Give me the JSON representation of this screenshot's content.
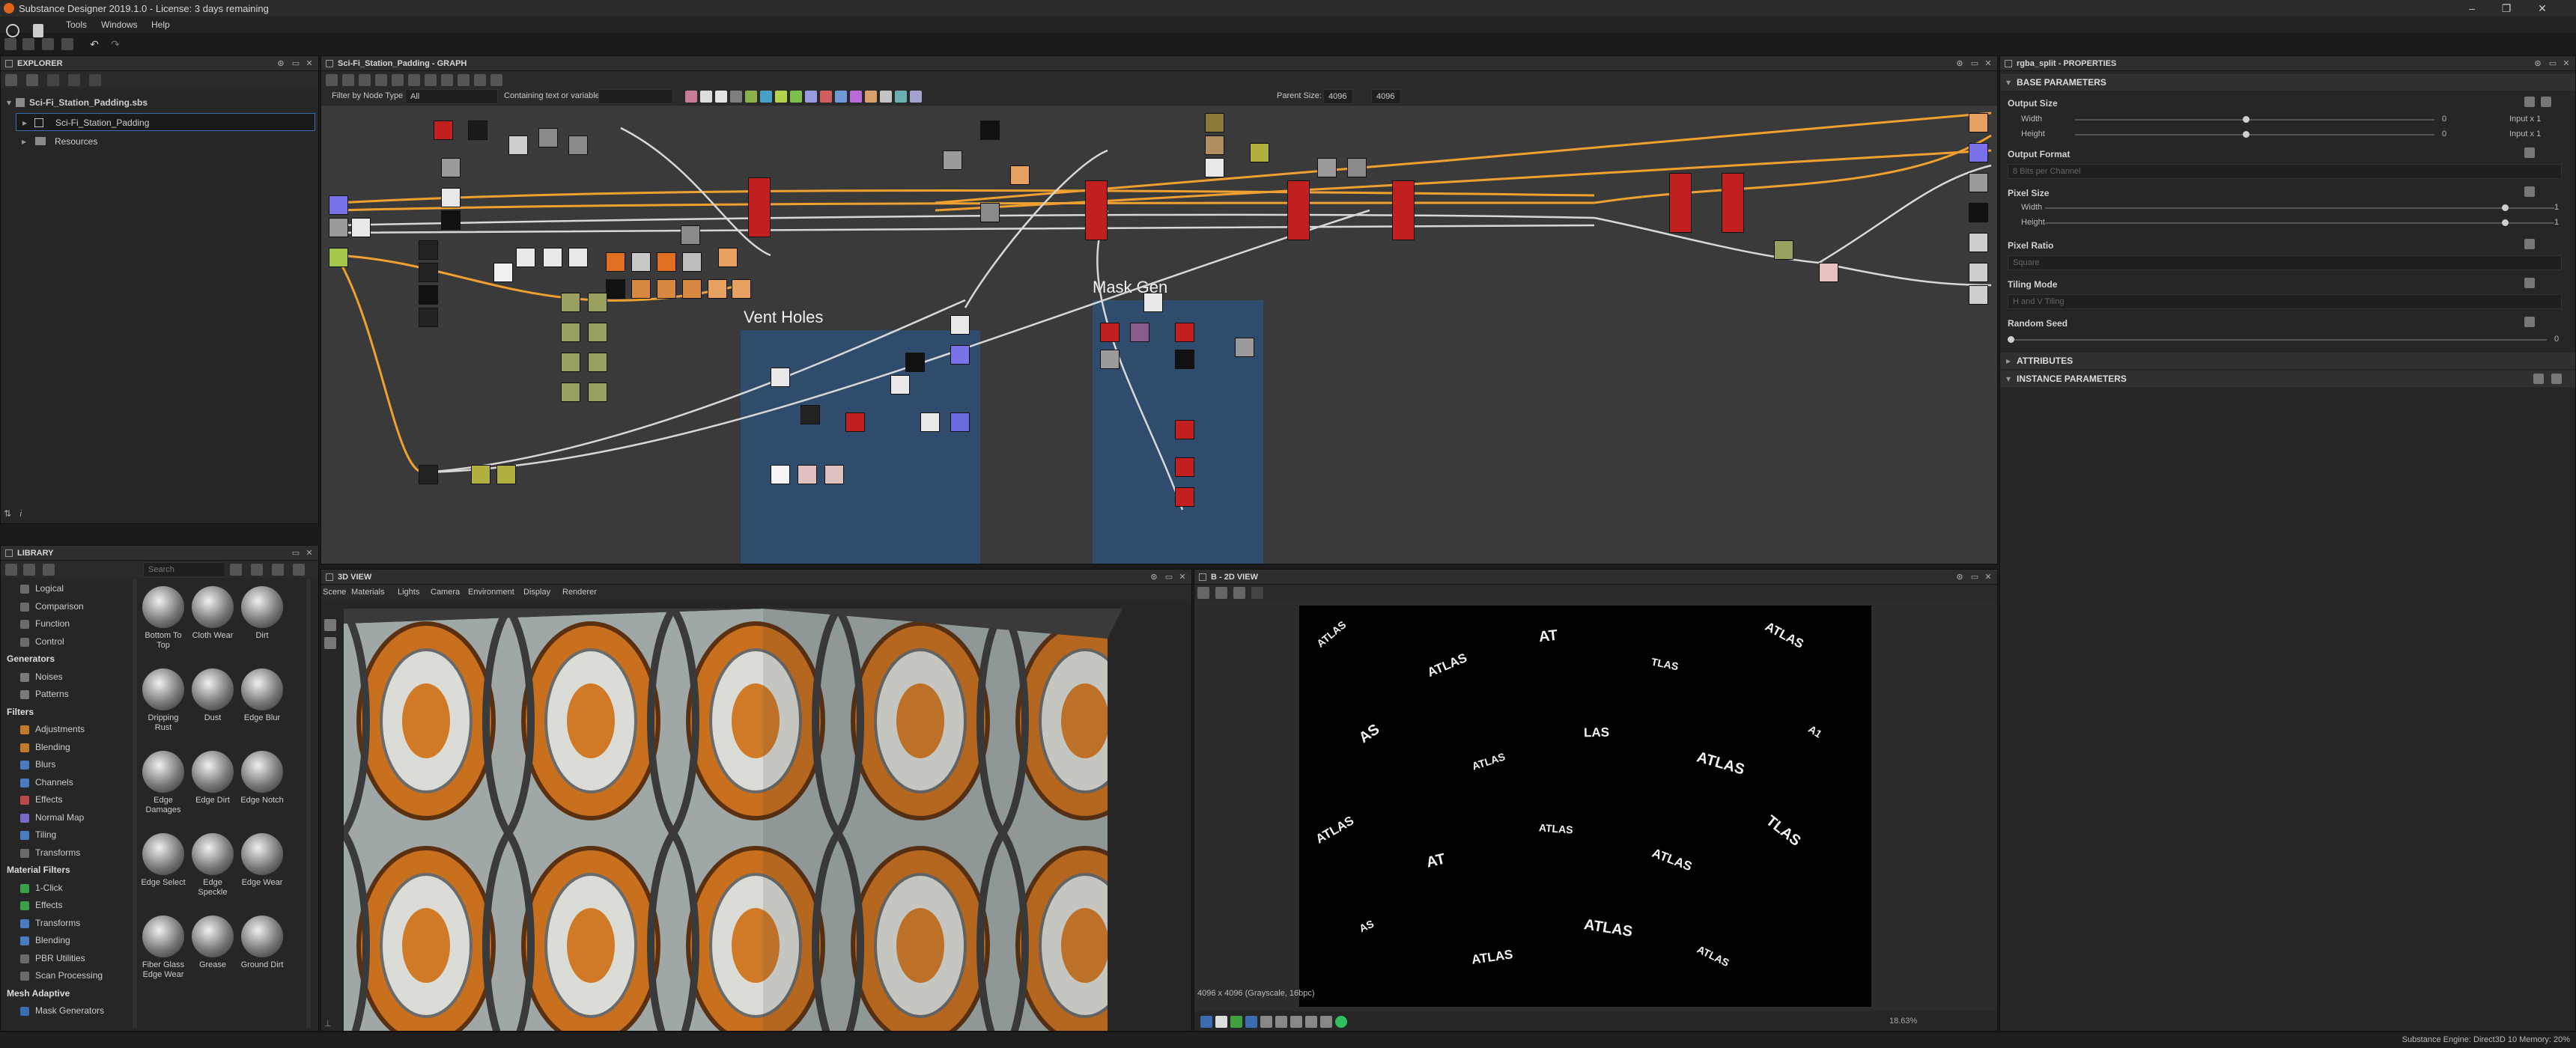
{
  "window": {
    "title": "Substance Designer 2019.1.0 - License: 3 days remaining",
    "controls": [
      "–",
      "❐",
      "✕"
    ]
  },
  "menubar": {
    "items": [
      "Tools",
      "Windows",
      "Help"
    ]
  },
  "explorer": {
    "title": "EXPLORER",
    "package": "Sci-Fi_Station_Padding.sbs",
    "graph": "Sci-Fi_Station_Padding",
    "folder": "Resources"
  },
  "graph_view": {
    "title": "Sci-Fi_Station_Padding - GRAPH",
    "filter_label": "Filter by Node Type",
    "filter_value": "All",
    "containing_label": "Containing text or variable",
    "parent_size_label": "Parent Size:",
    "parent_size_w": "4096",
    "parent_size_h": "4096",
    "frames": [
      {
        "title": "Vent Holes"
      },
      {
        "title": "Mask Gen"
      }
    ]
  },
  "library": {
    "title": "LIBRARY",
    "search_placeholder": "Search",
    "categories": [
      {
        "label": "Logical",
        "type": "item",
        "color": "#6b6b6b"
      },
      {
        "label": "Comparison",
        "type": "item",
        "color": "#6b6b6b"
      },
      {
        "label": "Function",
        "type": "item",
        "color": "#6b6b6b"
      },
      {
        "label": "Control",
        "type": "item",
        "color": "#6b6b6b"
      },
      {
        "label": "Generators",
        "type": "header"
      },
      {
        "label": "Noises",
        "type": "item",
        "color": "#7a7a7a"
      },
      {
        "label": "Patterns",
        "type": "item",
        "color": "#7a7a7a"
      },
      {
        "label": "Filters",
        "type": "header"
      },
      {
        "label": "Adjustments",
        "type": "item",
        "color": "#c07a2a"
      },
      {
        "label": "Blending",
        "type": "item",
        "color": "#c07a2a"
      },
      {
        "label": "Blurs",
        "type": "item",
        "color": "#4a7bc0"
      },
      {
        "label": "Channels",
        "type": "item",
        "color": "#4a7bc0"
      },
      {
        "label": "Effects",
        "type": "item",
        "color": "#b84a4a"
      },
      {
        "label": "Normal Map",
        "type": "item",
        "color": "#7a6ac8"
      },
      {
        "label": "Tiling",
        "type": "item",
        "color": "#4a7bc0"
      },
      {
        "label": "Transforms",
        "type": "item",
        "color": "#6b6b6b"
      },
      {
        "label": "Material Filters",
        "type": "header"
      },
      {
        "label": "1-Click",
        "type": "item",
        "color": "#3aa04a"
      },
      {
        "label": "Effects",
        "type": "item",
        "color": "#3aa04a"
      },
      {
        "label": "Transforms",
        "type": "item",
        "color": "#4a7bc0"
      },
      {
        "label": "Blending",
        "type": "item",
        "color": "#4a7bc0"
      },
      {
        "label": "PBR Utilities",
        "type": "item",
        "color": "#6b6b6b"
      },
      {
        "label": "Scan Processing",
        "type": "item",
        "color": "#6b6b6b"
      },
      {
        "label": "Mesh Adaptive",
        "type": "header"
      },
      {
        "label": "Mask Generators",
        "type": "item",
        "color": "#3a6cb0"
      }
    ],
    "thumbnails": [
      {
        "label": "Bottom To Top"
      },
      {
        "label": "Cloth Wear"
      },
      {
        "label": "Dirt"
      },
      {
        "label": "Dripping Rust"
      },
      {
        "label": "Dust"
      },
      {
        "label": "Edge Blur"
      },
      {
        "label": "Edge Damages"
      },
      {
        "label": "Edge Dirt"
      },
      {
        "label": "Edge Notch"
      },
      {
        "label": "Edge Select"
      },
      {
        "label": "Edge Speckle"
      },
      {
        "label": "Edge Wear"
      },
      {
        "label": "Fiber Glass Edge Wear"
      },
      {
        "label": "Grease"
      },
      {
        "label": "Ground Dirt"
      }
    ]
  },
  "view3d": {
    "title": "3D VIEW",
    "menu": [
      "Scene",
      "Materials",
      "Lights",
      "Camera",
      "Environment",
      "Display",
      "Renderer"
    ]
  },
  "view2d": {
    "title": "B - 2D VIEW",
    "info": "4096 x 4096 (Grayscale, 16bpc)",
    "zoom": "18.63%",
    "text_stamps": [
      "ATLAS",
      "ATLAS",
      "AT",
      "TLAS",
      "ATLAS",
      "AS",
      "ATLAS",
      "LAS",
      "ATLAS",
      "A1",
      "ATLAS",
      "AT",
      "ATLAS",
      "ATLAS",
      "TLAS",
      "AS",
      "ATLAS",
      "ATLAS",
      "ATLAS"
    ]
  },
  "properties": {
    "title": "rgba_split - PROPERTIES",
    "sections": {
      "base": "BASE PARAMETERS",
      "attributes": "ATTRIBUTES",
      "instance": "INSTANCE PARAMETERS"
    },
    "output_size": {
      "label": "Output Size",
      "width_label": "Width",
      "height_label": "Height",
      "width_value": "0",
      "height_value": "0",
      "width_mode": "Input x 1",
      "height_mode": "Input x 1"
    },
    "output_format": {
      "label": "Output Format",
      "value": "8 Bits per Channel"
    },
    "pixel_size": {
      "label": "Pixel Size",
      "width_label": "Width",
      "height_label": "Height",
      "width_value": "1",
      "height_value": "1"
    },
    "pixel_ratio": {
      "label": "Pixel Ratio",
      "value": "Square"
    },
    "tiling_mode": {
      "label": "Tiling Mode",
      "value": "H and V Tiling"
    },
    "random_seed": {
      "label": "Random Seed",
      "value": "0"
    }
  },
  "statusbar": {
    "text": "Substance Engine: Direct3D 10  Memory: 20%"
  }
}
